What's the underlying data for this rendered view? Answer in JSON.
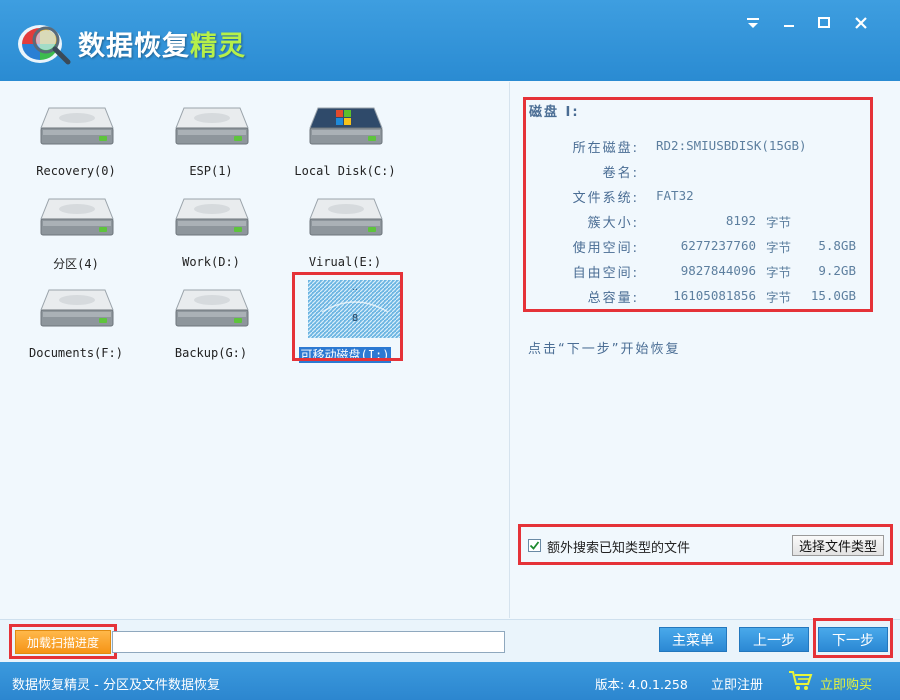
{
  "window": {
    "title_main": "数据恢复",
    "title_accent": "精灵",
    "controls": [
      "menu-icon",
      "minimize-icon",
      "maximize-icon",
      "close-icon"
    ]
  },
  "drives": [
    {
      "label": "Recovery(0)",
      "icon": "hard-drive-icon"
    },
    {
      "label": "ESP(1)",
      "icon": "hard-drive-icon"
    },
    {
      "label": "Local Disk(C:)",
      "icon": "windows-drive-icon"
    },
    {
      "label": "分区(4)",
      "icon": "hard-drive-icon"
    },
    {
      "label": "Work(D:)",
      "icon": "hard-drive-icon"
    },
    {
      "label": "Virual(E:)",
      "icon": "hard-drive-icon"
    },
    {
      "label": "Documents(F:)",
      "icon": "hard-drive-icon"
    },
    {
      "label": "Backup(G:)",
      "icon": "hard-drive-icon"
    },
    {
      "label": "可移动磁盘(I:)",
      "icon": "removable-drive-icon",
      "selected": true
    }
  ],
  "info": {
    "title": "磁盘 I:",
    "disk_label": "所在磁盘:",
    "disk_value": "RD2:SMIUSBDISK(15GB)",
    "volume_label": "卷名:",
    "volume_value": "",
    "fs_label": "文件系统:",
    "fs_value": "FAT32",
    "cluster_label": "簇大小:",
    "cluster_value": "8192",
    "cluster_unit": "字节",
    "used_label": "使用空间:",
    "used_value": "6277237760",
    "used_unit": "字节",
    "used_size": "5.8GB",
    "free_label": "自由空间:",
    "free_value": "9827844096",
    "free_unit": "字节",
    "free_size": "9.2GB",
    "total_label": "总容量:",
    "total_value": "16105081856",
    "total_unit": "字节",
    "total_size": "15.0GB"
  },
  "hint": "点击“下一步”开始恢复",
  "options": {
    "extra_search_label": "额外搜索已知类型的文件",
    "extra_search_checked": true,
    "filetype_button": "选择文件类型"
  },
  "toolbar": {
    "load_progress": "加载扫描进度",
    "main_menu": "主菜单",
    "prev": "上一步",
    "next": "下一步"
  },
  "status": {
    "text": "数据恢复精灵 - 分区及文件数据恢复",
    "version": "版本: 4.0.1.258",
    "register": "立即注册",
    "buy": "立即购买"
  },
  "colors": {
    "title_bar": "#2a8bd2",
    "accent_green": "#b6f04a",
    "highlight_red": "#e53238",
    "button_blue": "#2b88d4",
    "button_orange": "#f59416"
  }
}
